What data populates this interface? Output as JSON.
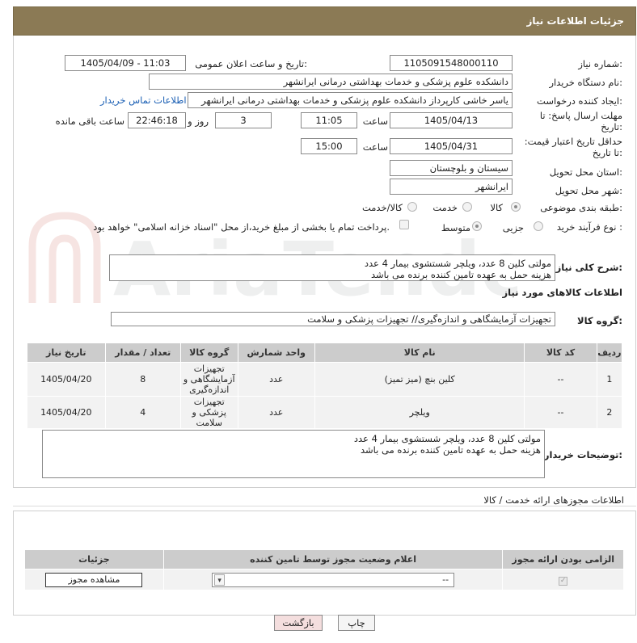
{
  "header": {
    "title": "جزئیات اطلاعات نیاز"
  },
  "fields": {
    "need_number_label": "شماره نیاز:",
    "need_number": "1105091548000110",
    "announce_label": "تاریخ و ساعت اعلان عمومی:",
    "announce_value": "1405/04/09 - 11:03",
    "buyer_org_label": "نام دستگاه خریدار:",
    "buyer_org": "دانشکده علوم پزشکی و خدمات بهداشتی درمانی ایرانشهر",
    "requester_label": "ایجاد کننده درخواست:",
    "requester": "یاسر خاشی کارپرداز دانشکده علوم پزشکی و خدمات بهداشتی درمانی ایرانشهر",
    "contact_link": "اطلاعات تماس خریدار",
    "reply_deadline_label": "مهلت ارسال پاسخ: تا تاریخ:",
    "reply_date": "1405/04/13",
    "time_label": "ساعت",
    "reply_time": "11:05",
    "days_value": "3",
    "days_label": "روز و",
    "remaining_time": "22:46:18",
    "remaining_label": "ساعت باقی مانده",
    "price_validity_label": "حداقل تاریخ اعتبار قیمت: تا تاریخ:",
    "price_date": "1405/04/31",
    "price_time": "15:00",
    "province_label": "استان محل تحویل:",
    "province": "سیستان و بلوچستان",
    "city_label": "شهر محل تحویل:",
    "city": "ایرانشهر",
    "category_label": "طبقه بندی موضوعی:",
    "category_options": [
      "کالا",
      "خدمت",
      "کالا/خدمت"
    ],
    "process_label": "نوع فرآیند خرید :",
    "process_options": [
      "جزیی",
      "متوسط"
    ],
    "payment_note": "پرداخت تمام یا بخشی از مبلغ خرید،از محل \"اسناد خزانه اسلامی\" خواهد بود."
  },
  "summary": {
    "label": "شرح کلی نیاز:",
    "text": "مولتی کلین 8 عدد، ویلچر شستشوی بیمار 4 عدد\nهزینه حمل به عهده تامین کننده برنده می باشد"
  },
  "goods_section": {
    "title": "اطلاعات کالاهای مورد نیاز",
    "group_label": "گروه کالا:",
    "group_value": "تجهیزات آزمایشگاهی و اندازه‌گیری// تجهیزات پزشکی و سلامت"
  },
  "goods_table": {
    "headers": [
      "ردیف",
      "کد کالا",
      "نام کالا",
      "واحد شمارش",
      "گروه کالا",
      "تعداد / مقدار",
      "تاریخ نیاز"
    ],
    "rows": [
      {
        "row": "1",
        "code": "--",
        "name": "کلین بنچ (میز تمیز)",
        "unit": "عدد",
        "group": "تجهیزات آزمایشگاهی و اندازه‌گیری",
        "qty": "8",
        "date": "1405/04/20"
      },
      {
        "row": "2",
        "code": "--",
        "name": "ویلچر",
        "unit": "عدد",
        "group": "تجهیزات پزشکی و سلامت",
        "qty": "4",
        "date": "1405/04/20"
      }
    ]
  },
  "buyer_notes": {
    "label": "توضیحات خریدار:",
    "text": "مولتی کلین 8 عدد، ویلچر شستشوی بیمار 4 عدد\nهزینه حمل به عهده تامین کننده برنده می باشد"
  },
  "permits": {
    "title": "اطلاعات مجوزهای ارائه خدمت / کالا",
    "headers": [
      "الزامی بودن ارائه مجوز",
      "اعلام وضعیت مجوز توسط تامین کننده",
      "جزئیات"
    ],
    "select_value": "--",
    "view_button": "مشاهده مجوز"
  },
  "buttons": {
    "print": "چاپ",
    "back": "بازگشت"
  },
  "watermark": "AriaTender.neT",
  "colors": {
    "header_bg": "#8b7a55",
    "link": "#1a5fb4",
    "table_head": "#cccccc",
    "back_btn": "#f4dede"
  }
}
